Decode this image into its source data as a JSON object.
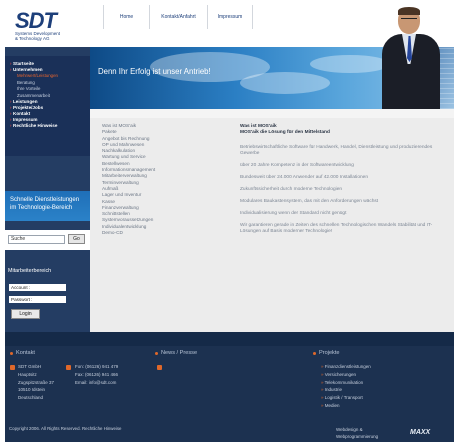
{
  "header": {
    "logo_text": "SDT",
    "logo_sub_1": "Systems Development",
    "logo_sub_2": "& Technology AG",
    "nav": [
      "Home",
      "Kontakt/Anfahrt",
      "Impressum"
    ]
  },
  "leftnav": {
    "items": [
      {
        "label": "Startseite"
      },
      {
        "label": "Unternehmen"
      }
    ],
    "subitems": [
      "Mehrwert/Leistungen",
      "Beratung",
      "Ihre Vorteile",
      "Zusammenarbeit"
    ],
    "items2": [
      "Leistungen",
      "Projekte/Jobs",
      "Kontakt",
      "Impressum",
      "Rechtliche Hinweise"
    ]
  },
  "promo": {
    "line1": "Schnelle Dienstleistungen",
    "line2": "im Technologie-Bereich"
  },
  "search": {
    "value": "Suche",
    "button": "Go"
  },
  "login": {
    "title": "Mitarbeiterbereich",
    "account_label": "Account :",
    "password_label": "Passwort :",
    "button": "Login"
  },
  "hero": {
    "slogan": "Denn Ihr Erfolg ist unser Antrieb!"
  },
  "content": {
    "list": [
      "Was ist MOS'aik",
      "Pakete",
      "Angebot bis Rechnung",
      "OP und Mahnwesen",
      "Nachkalkulation",
      "Wartung und Service",
      "Bestellwesen",
      "Informationsmanagement",
      "Mitarbeiterverwaltung",
      "Terminverwaltung",
      "Aufmaß",
      "Lager und Inventur",
      "Kasse",
      "Finanzverwaltung",
      "Schnittstellen",
      "Systemvoraussetzungen",
      "Individualentwicklung",
      "Demo-CD"
    ],
    "title_1": "Was ist MOS'aik",
    "title_2": "MOS'aik die Lösung für den Mittelstand",
    "paragraphs": [
      "Betriebswirtschaftliche Software für Handwerk, Handel, Dienstleistung und produzierendes Gewerbe",
      "über 20 Jahre Kompetenz in der Softwareentwicklung",
      "Bundesweit über 24.000 Anwender auf 42.000 Installationen",
      "Zukunftssicherheit durch moderne Technologien",
      "Modulares Baukastensystem, das mit den Anforderungen wächst",
      "Individualisierung wenn der Standard nicht genügt",
      "Wir garantieren gerade in Zeiten des schnellen Technologischen Wandels Stabilität und IT-Lösungen auf Basis moderner Technologie!"
    ]
  },
  "footer": {
    "kontakt": {
      "title": "Kontakt",
      "address": [
        "SDT GmbH",
        "Hauptsitz",
        "Zugspitzstraße 37",
        "10510 Idstein",
        "Deutschland"
      ],
      "tel": [
        "Fon: (06126) 941 479",
        "Fax: (06126) 941 466",
        "Email: info@sdt.com"
      ]
    },
    "news": {
      "title": "News / Presse"
    },
    "projekte": {
      "title": "Projekte",
      "items": [
        "Finanzdienstleistungen",
        "Versicherungen",
        "Telekommunikation",
        "Industrie",
        "Logistik / Transport",
        "Medien"
      ]
    },
    "copyright": "Copyright 2006. All Rights Reserved. Rechtliche Hinweise",
    "webdesign_1": "Webdesign &",
    "webdesign_2": "Webprogrammierung",
    "maxx": "MAXX"
  },
  "colors": {
    "brand": "#1d3f7a",
    "accent": "#e0682a",
    "leftcol": "#243d63"
  }
}
